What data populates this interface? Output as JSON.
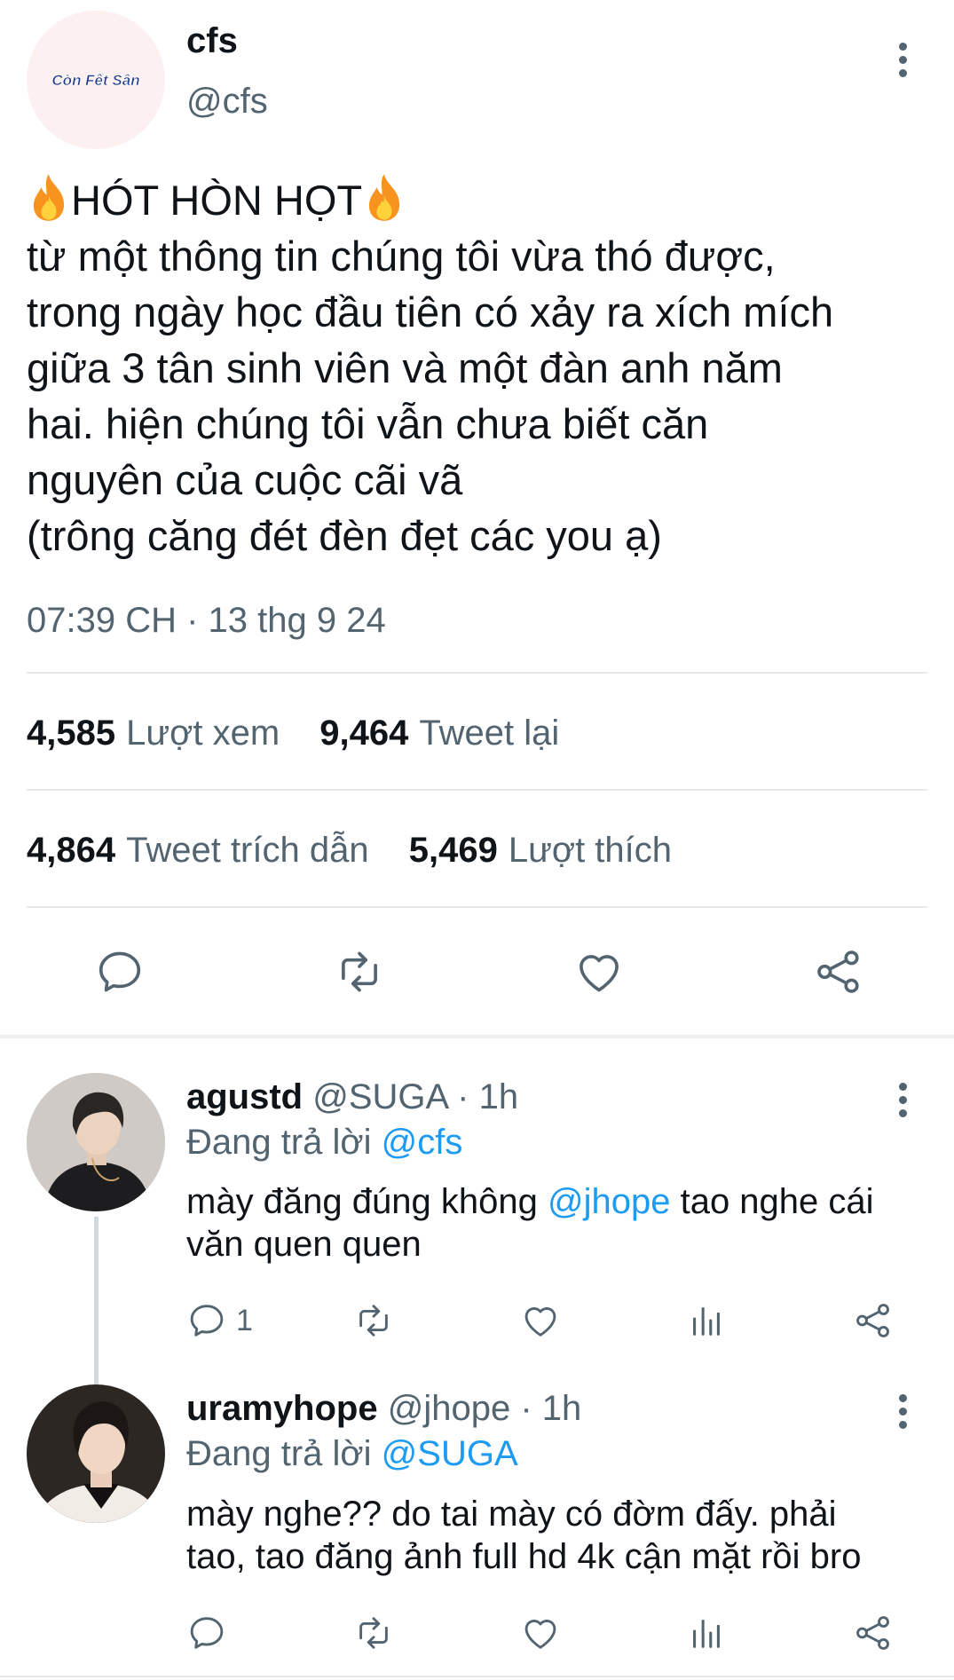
{
  "tweet": {
    "avatar_text": "Còn Fết Sân",
    "author_name": "cfs",
    "author_handle": "@cfs",
    "text_title": "HÓT HÒN HỌT",
    "text_lines": [
      "từ một thông tin chúng tôi vừa thó được,",
      "trong ngày học đầu tiên có xảy ra xích mích",
      "giữa 3 tân sinh viên và một đàn anh năm",
      "hai. hiện chúng tôi vẫn chưa biết căn",
      "nguyên của cuộc cãi vã",
      "(trông căng đét đèn đẹt các you ạ)"
    ],
    "timestamp": "07:39 CH · 13 thg 9 24",
    "stats": {
      "views_count": "4,585",
      "views_label": "Lượt xem",
      "retweets_count": "9,464",
      "retweets_label": "Tweet lại",
      "quotes_count": "4,864",
      "quotes_label": "Tweet trích dẫn",
      "likes_count": "5,469",
      "likes_label": "Lượt thích"
    },
    "actions": [
      "reply-icon",
      "retweet-icon",
      "like-icon",
      "share-icon"
    ]
  },
  "replies": [
    {
      "name": "agustd",
      "handle": "@SUGA",
      "time": "· 1h",
      "replying_prefix": "Đang trả lời",
      "replying_to": "@cfs",
      "body_line1_pre": "mày đăng đúng không ",
      "body_line1_mention": "@jhope",
      "body_line1_post": " tao nghe cái",
      "body_line2": "văn quen quen",
      "reply_count": "1"
    },
    {
      "name": "uramyhope",
      "handle": "@jhope",
      "time": "· 1h",
      "replying_prefix": "Đang trả lời",
      "replying_to": "@SUGA",
      "body_line1": "mày nghe?? do tai mày có đờm đấy. phải",
      "body_line2": "tao, tao đăng ảnh full hd 4k cận mặt rồi bro",
      "reply_count": ""
    }
  ],
  "colors": {
    "text": "#0f1419",
    "muted": "#536471",
    "link": "#1d9bf0",
    "divider": "#e6e9eb"
  }
}
